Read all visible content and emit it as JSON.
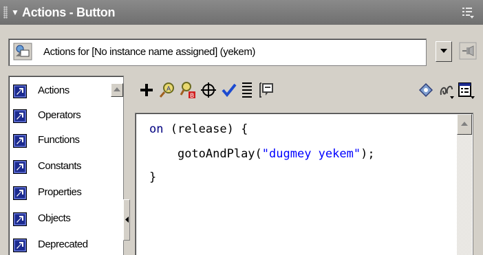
{
  "panel": {
    "title": "Actions - Button",
    "collapse_glyph": "▼",
    "menu_icon": "panel-options-menu-icon"
  },
  "target": {
    "icon": "button-symbol-icon",
    "label": "Actions for [No instance name assigned] (yekem)"
  },
  "toolbox": {
    "items": [
      {
        "label": "Actions",
        "icon": "book-icon"
      },
      {
        "label": "Operators",
        "icon": "book-icon"
      },
      {
        "label": "Functions",
        "icon": "book-icon"
      },
      {
        "label": "Constants",
        "icon": "book-icon"
      },
      {
        "label": "Properties",
        "icon": "book-icon"
      },
      {
        "label": "Objects",
        "icon": "book-icon"
      },
      {
        "label": "Deprecated",
        "icon": "book-icon"
      }
    ]
  },
  "toolbar": {
    "buttons": [
      "add-statement-icon",
      "find-icon",
      "replace-icon",
      "insert-target-path-icon",
      "check-syntax-icon",
      "auto-format-icon",
      "show-code-hint-icon",
      "reference-icon",
      "debug-options-icon",
      "view-options-icon"
    ]
  },
  "editor": {
    "lines": [
      {
        "kw": "on",
        "rest": " (release) {"
      },
      {
        "indent": "    ",
        "fn": "gotoAndPlay(",
        "str": "\"dugmey yekem\"",
        "end": ");"
      },
      {
        "text": "}"
      }
    ]
  },
  "colors": {
    "titlebar": "#777777",
    "panel_bg": "#d4d0c8",
    "keyword": "#000080",
    "string": "#0000ff",
    "book_icon_bg": "#1b2a8f"
  }
}
